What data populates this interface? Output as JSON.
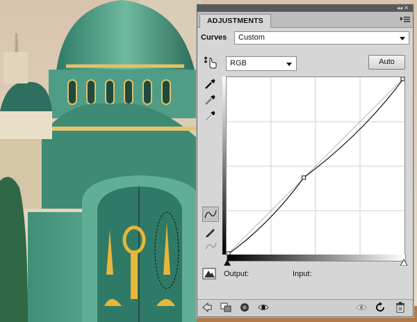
{
  "panel": {
    "tab_label": "ADJUSTMENTS",
    "title_controls": "◂◂ ✕"
  },
  "curves": {
    "label": "Curves",
    "preset_value": "Custom",
    "channel_value": "RGB",
    "auto_label": "Auto",
    "output_label": "Output:",
    "input_label": "Input:",
    "curve_points": [
      [
        0,
        0
      ],
      [
        0.434,
        0.436
      ],
      [
        1,
        1
      ]
    ]
  },
  "icons": {
    "tools": [
      "on-image-adjust-icon",
      "black-point-eyedropper-icon",
      "gray-point-eyedropper-icon",
      "white-point-eyedropper-icon"
    ],
    "curve_tools": [
      "curve-edit-points-icon",
      "pencil-draw-icon",
      "smooth-curve-icon",
      "clipping-warning-icon"
    ],
    "bottom_left": [
      "back-arrow-icon",
      "clip-to-layer-icon",
      "visibility-toggle-icon",
      "eye-icon"
    ],
    "bottom_right": [
      "view-previous-icon",
      "reset-icon",
      "trash-icon"
    ]
  }
}
